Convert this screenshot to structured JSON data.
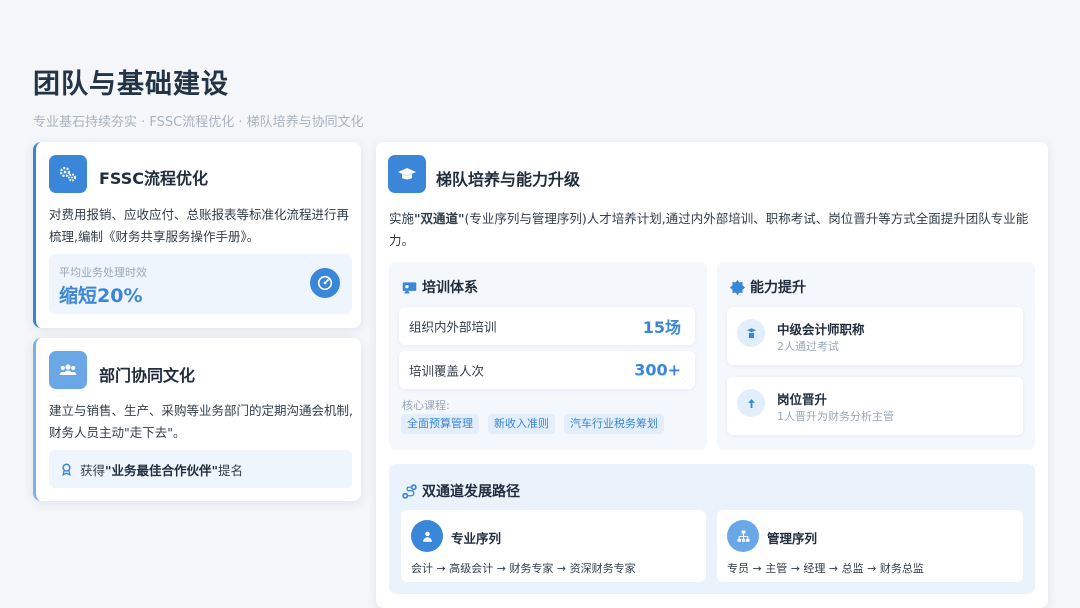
{
  "header": {
    "title": "团队与基础建设",
    "subtitle": "专业基石持续夯实 · FSSC流程优化 · 梯队培养与协同文化"
  },
  "fssc": {
    "title": "FSSC流程优化",
    "desc": "对费用报销、应收应付、总账报表等标准化流程进行再梳理,编制《财务共享服务操作手册》。",
    "metric_label": "平均业务处理时效",
    "metric_value": "缩短20%",
    "icon": "gears-icon"
  },
  "culture": {
    "title": "部门协同文化",
    "desc": "建立与销售、生产、采购等业务部门的定期沟通会机制,财务人员主动\"走下去\"。",
    "award_prefix": "获得",
    "award_bold": "\"业务最佳合作伙伴\"",
    "award_suffix": "提名",
    "icon": "people-icon"
  },
  "talent": {
    "title": "梯队培养与能力升级",
    "intro_prefix": "实施",
    "intro_bold": "\"双通道\"",
    "intro_rest": "(专业序列与管理序列)人才培养计划,通过内外部培训、职称考试、岗位晋升等方式全面提升团队专业能力。",
    "icon": "graduation-cap-icon",
    "training": {
      "title": "培训体系",
      "rows": [
        {
          "label": "组织内外部培训",
          "value": "15场"
        },
        {
          "label": "培训覆盖人次",
          "value": "300+"
        }
      ],
      "course_label": "核心课程:",
      "courses": [
        "全面预算管理",
        "新收入准则",
        "汽车行业税务筹划"
      ]
    },
    "ability": {
      "title": "能力提升",
      "items": [
        {
          "title": "中级会计师职称",
          "sub": "2人通过考试",
          "icon": "certificate-icon"
        },
        {
          "title": "岗位晋升",
          "sub": "1人晋升为财务分析主管",
          "icon": "arrow-up-icon"
        }
      ]
    },
    "paths": {
      "title": "双通道发展路径",
      "items": [
        {
          "title": "专业序列",
          "path": "会计 → 高级会计 → 财务专家 → 资深财务专家",
          "icon": "person-icon"
        },
        {
          "title": "管理序列",
          "path": "专员 → 主管 → 经理 → 总监 → 财务总监",
          "icon": "org-chart-icon"
        }
      ]
    }
  }
}
